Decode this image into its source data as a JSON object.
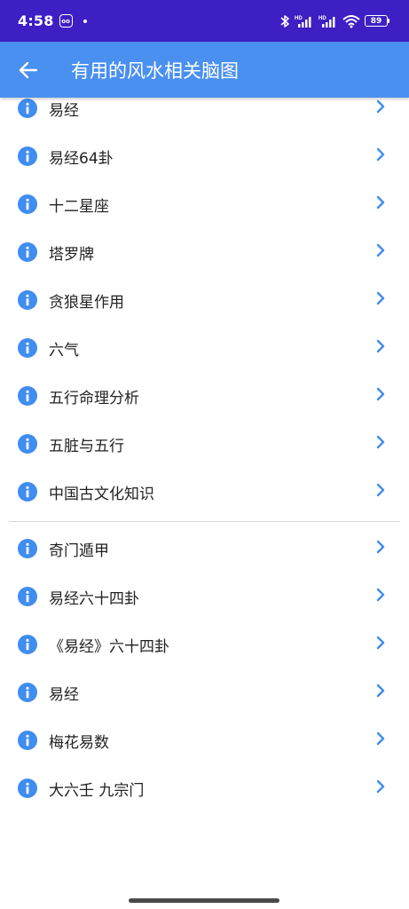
{
  "status_bar": {
    "time": "4:58",
    "battery": "89",
    "app_icon_text": "oo"
  },
  "app_bar": {
    "title": "有用的风水相关脑图"
  },
  "colors": {
    "status_bar": "#3d1fc4",
    "app_bar": "#4a90f0",
    "accent": "#3f8df0"
  },
  "list": {
    "group1": [
      {
        "label": "易经",
        "icon": "info-icon"
      },
      {
        "label": "易经64卦",
        "icon": "info-icon"
      },
      {
        "label": "十二星座",
        "icon": "info-icon"
      },
      {
        "label": "塔罗牌",
        "icon": "info-icon"
      },
      {
        "label": "贪狼星作用",
        "icon": "info-icon"
      },
      {
        "label": "六气",
        "icon": "info-icon"
      },
      {
        "label": "五行命理分析",
        "icon": "info-icon"
      },
      {
        "label": "五脏与五行",
        "icon": "info-icon"
      },
      {
        "label": "中国古文化知识",
        "icon": "info-icon"
      }
    ],
    "group2": [
      {
        "label": "奇门遁甲",
        "icon": "info-icon"
      },
      {
        "label": "易经六十四卦",
        "icon": "info-icon"
      },
      {
        "label": "《易经》六十四卦",
        "icon": "info-icon"
      },
      {
        "label": "易经",
        "icon": "info-icon"
      },
      {
        "label": "梅花易数",
        "icon": "info-icon"
      },
      {
        "label": "大六壬 九宗门",
        "icon": "info-icon"
      }
    ]
  }
}
